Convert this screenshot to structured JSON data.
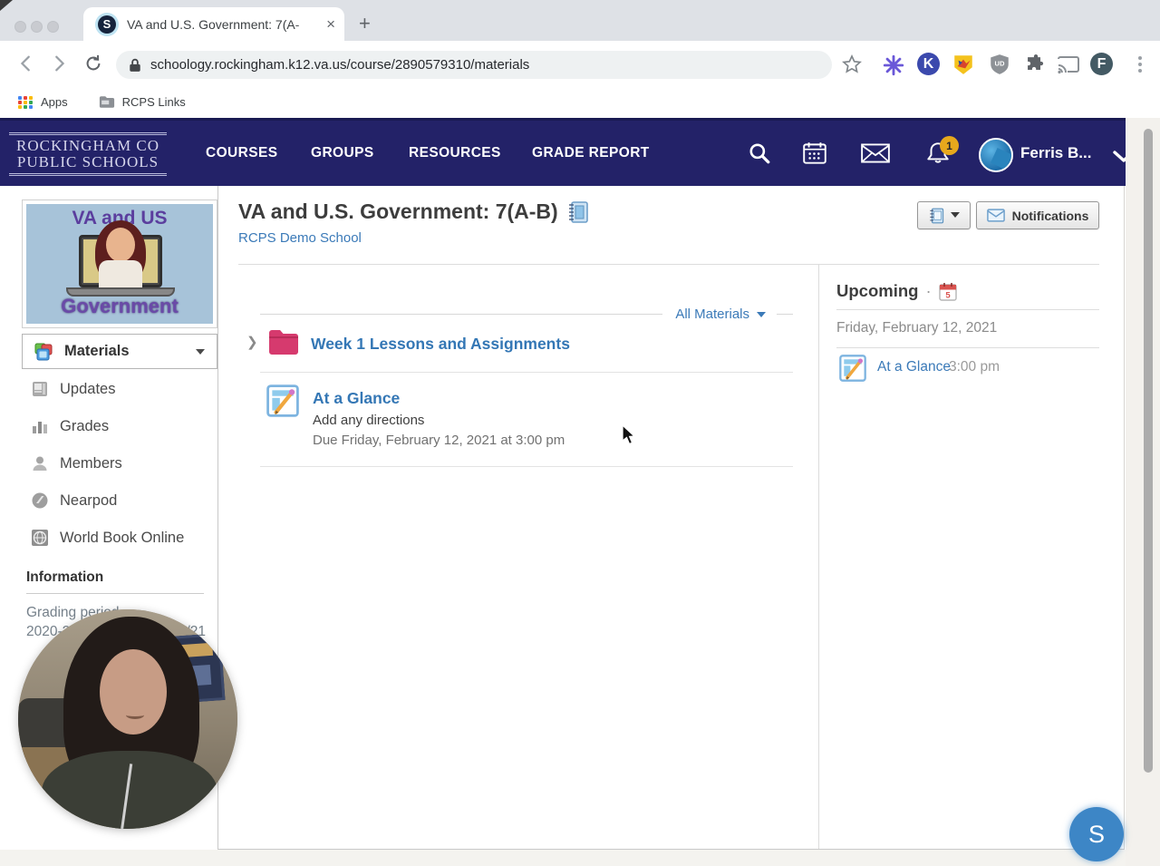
{
  "browser": {
    "tab_title": "VA and U.S. Government: 7(A-",
    "tab_favicon_letter": "S",
    "tab_close": "×",
    "new_tab": "+",
    "url": "schoology.rockingham.k12.va.us/course/2890579310/materials",
    "bookmarks": {
      "apps_label": "Apps",
      "rcps_label": "RCPS Links"
    },
    "extensions": {
      "kami_letter": "K",
      "ublock_letters": "UD",
      "profile_initial": "F"
    }
  },
  "navbar": {
    "logo_line1": "ROCKINGHAM CO",
    "logo_line2": "PUBLIC SCHOOLS",
    "links": [
      "COURSES",
      "GROUPS",
      "RESOURCES",
      "GRADE REPORT"
    ],
    "notification_count": "1",
    "user_name": "Ferris B..."
  },
  "sidebar": {
    "course_image": {
      "line1": "VA and US",
      "line2": "Government"
    },
    "items": [
      {
        "label": "Materials"
      },
      {
        "label": "Updates"
      },
      {
        "label": "Grades"
      },
      {
        "label": "Members"
      },
      {
        "label": "Nearpod"
      },
      {
        "label": "World Book Online"
      }
    ],
    "info_heading": "Information",
    "grading_label": "Grading period",
    "grading_left": "2020-2",
    "grading_right": "/21"
  },
  "main": {
    "title": "VA and U.S. Government: 7(A-B)",
    "school": "RCPS Demo School",
    "notifications_button": "Notifications",
    "filter_label": "All Materials",
    "folder_chevron": "❯",
    "folder_title": "Week 1 Lessons and Assignments",
    "assignment": {
      "title": "At a Glance",
      "description": "Add any directions",
      "due": "Due Friday, February 12, 2021 at 3:00 pm"
    }
  },
  "upcoming": {
    "heading": "Upcoming",
    "separator": "·",
    "calendar_day": "5",
    "date": "Friday, February 12, 2021",
    "event_title": "At a Glance",
    "event_time": "3:00 pm"
  },
  "overlay": {
    "screencast_letter": "S"
  },
  "colors": {
    "navy": "#232268",
    "link_blue": "#3b7ab8",
    "folder_pink": "#d63a6e",
    "badge_yellow": "#e7a81c"
  }
}
